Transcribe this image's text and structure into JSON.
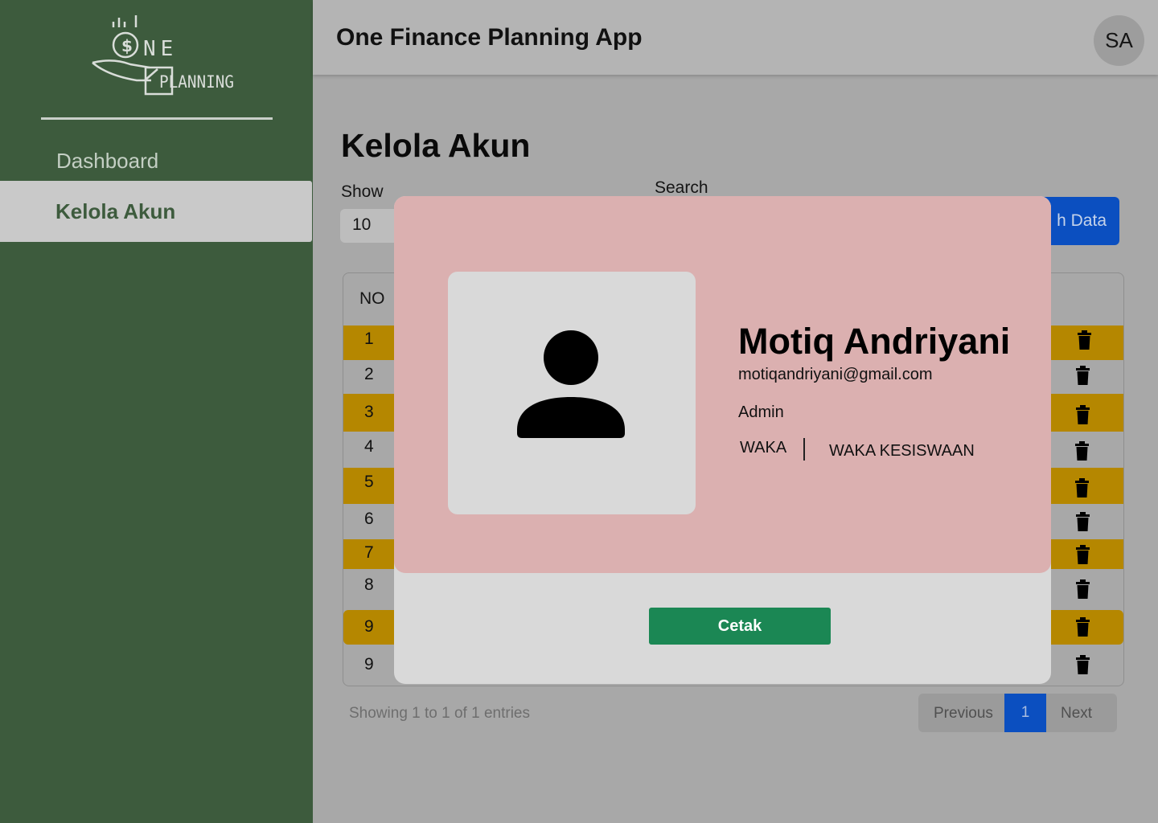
{
  "sidebar": {
    "logo": {
      "text_top": "NE",
      "text_bottom": "PLANNING"
    },
    "items": [
      {
        "label": "Dashboard",
        "active": false
      },
      {
        "label": "Kelola Akun",
        "active": true
      }
    ]
  },
  "header": {
    "title": "One Finance Planning App",
    "avatar_initials": "SA"
  },
  "main": {
    "page_title": "Kelola Akun",
    "show_label": "Show",
    "show_value": "10",
    "search_label": "Search",
    "add_button_label": "h Data",
    "table": {
      "col_no": "NO",
      "rows": [
        {
          "no": "1",
          "highlight": true
        },
        {
          "no": "2",
          "highlight": false
        },
        {
          "no": "3",
          "highlight": true
        },
        {
          "no": "4",
          "highlight": false
        },
        {
          "no": "5",
          "highlight": true
        },
        {
          "no": "6",
          "highlight": false
        },
        {
          "no": "7",
          "highlight": true
        },
        {
          "no": "8",
          "highlight": false
        },
        {
          "no": "9",
          "highlight": true
        },
        {
          "no": "9",
          "highlight": false
        }
      ]
    },
    "showing_text": "Showing 1 to 1 of 1 entries",
    "pagination": {
      "previous": "Previous",
      "current": "1",
      "next": "Next"
    }
  },
  "modal": {
    "name": "Motiq Andriyani",
    "email": "motiqandriyani@gmail.com",
    "role": "Admin",
    "jabatan": "WAKA",
    "bagian": "WAKA KESISWAAN",
    "print_label": "Cetak"
  },
  "colors": {
    "sidebar": "#3d5b3d",
    "highlight_row": "#b58700",
    "primary": "#0b4fc0",
    "card": "#dbb0b0",
    "print_button": "#1b8754"
  }
}
